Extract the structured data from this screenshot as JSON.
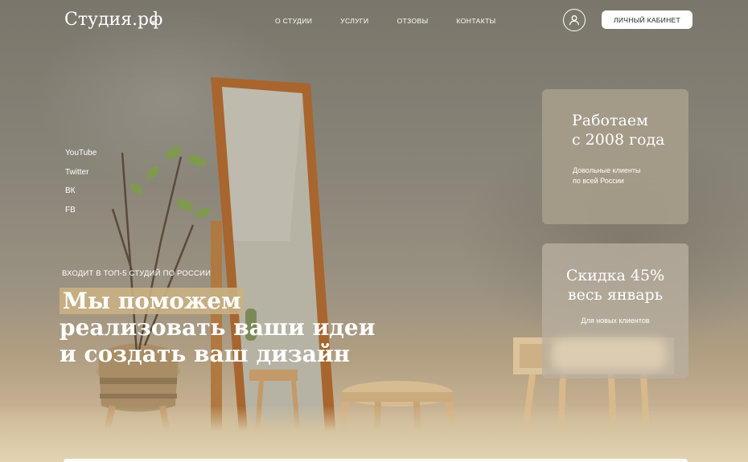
{
  "header": {
    "logo": "Студия.рф",
    "nav": [
      "О СТУДИИ",
      "УСЛУГИ",
      "ОТЗОВЫ",
      "КОНТАКТЫ"
    ],
    "cabinet_label": "ЛИЧНЫЙ КАБИНЕТ",
    "user_icon": "user-icon",
    "logo_icon": "feather-arrow-icon"
  },
  "socials": [
    "YouTube",
    "Twitter",
    "ВК",
    "FB"
  ],
  "hero": {
    "tagline": "ВХОДИТ В ТОП-5 СТУДИЙ ПО РОССИИ",
    "headline_line1": "Мы поможем",
    "headline_line2": "реализовать ваши идеи",
    "headline_line3": "и создать ваш дизайн"
  },
  "cards": [
    {
      "title_line1": "Работаем",
      "title_line2": "с 2008 года",
      "text_line1": "Довольные клиенты",
      "text_line2": "по всей России"
    },
    {
      "title_line1": "Скидка 45%",
      "title_line2": "весь январь",
      "text": "Для новых клиентов"
    }
  ],
  "colors": {
    "accent": "#c9b083",
    "button_bg": "#ffffff",
    "card_bg": "#aaa08c"
  }
}
